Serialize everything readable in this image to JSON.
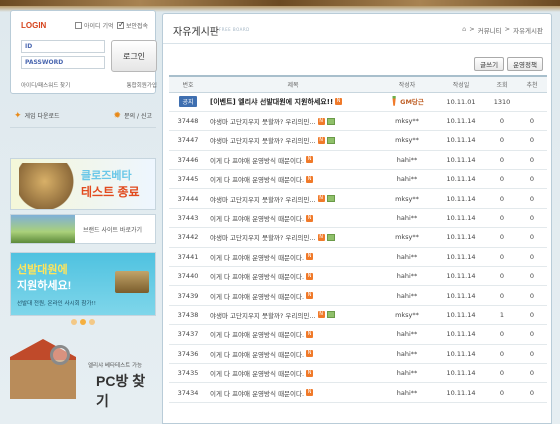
{
  "sidebar": {
    "login": {
      "title": "LOGIN",
      "save_id_label": "아이디 기억",
      "security_label": "보안접속",
      "id_label": "ID",
      "password_label": "PASSWORD",
      "login_button": "로그인",
      "find_link": "아이디/패스워드 찾기",
      "join_link": "통합회원가입"
    },
    "quick": {
      "download": "게임 다운로드",
      "support": "문의 / 신고"
    },
    "banner_cbt": {
      "line1": "클로즈베타",
      "line2": "테스트 종료"
    },
    "banner_brand": {
      "text": "브랜드 사이트 바로가기"
    },
    "banner_recruit": {
      "line1": "선발대원에",
      "line2": "지원하세요!",
      "line3": "선발대 전원, 온라인 사시회 참가!!"
    },
    "banner_pcbang": {
      "small": "엘리샤 베타테스트 가능",
      "big": "PC방 찾기"
    }
  },
  "board": {
    "title": "자유게시판",
    "subtitle": "FREE BOARD",
    "breadcrumb": [
      "커뮤니티",
      "자유게시판"
    ],
    "write_button": "글쓰기",
    "policy_button": "운영정책",
    "columns": [
      "번호",
      "제목",
      "작성자",
      "작성일",
      "조회",
      "추천"
    ],
    "notice": {
      "badge": "공지",
      "subject": "[이벤트] 엘리샤 선발대원에 지원하세요!!",
      "author": "GM당근",
      "date": "10.11.01",
      "views": "1310",
      "recommend": ""
    },
    "rows": [
      {
        "no": "37448",
        "subject": "야생마 고단지우지 뭇할까? 우리의민...",
        "img": true,
        "author": "mksy**",
        "date": "10.11.14",
        "views": "0",
        "recommend": "0"
      },
      {
        "no": "37447",
        "subject": "야생마 고단지우지 뭇할까? 우리의민...",
        "img": true,
        "author": "mksy**",
        "date": "10.11.14",
        "views": "0",
        "recommend": "0"
      },
      {
        "no": "37446",
        "subject": "이게 다 프야애 운영방식 때문이다.",
        "img": false,
        "author": "hahi**",
        "date": "10.11.14",
        "views": "0",
        "recommend": "0"
      },
      {
        "no": "37445",
        "subject": "이게 다 프야애 운영방식 때문이다.",
        "img": false,
        "author": "hahi**",
        "date": "10.11.14",
        "views": "0",
        "recommend": "0"
      },
      {
        "no": "37444",
        "subject": "야생마 고단지우지 뭇할까? 우리의민...",
        "img": true,
        "author": "mksy**",
        "date": "10.11.14",
        "views": "0",
        "recommend": "0"
      },
      {
        "no": "37443",
        "subject": "이게 다 프야애 운영방식 때문이다.",
        "img": false,
        "author": "hahi**",
        "date": "10.11.14",
        "views": "0",
        "recommend": "0"
      },
      {
        "no": "37442",
        "subject": "야생마 고단지우지 뭇할까? 우리의민...",
        "img": true,
        "author": "mksy**",
        "date": "10.11.14",
        "views": "0",
        "recommend": "0"
      },
      {
        "no": "37441",
        "subject": "이게 다 프야애 운영방식 때문이다.",
        "img": false,
        "author": "hahi**",
        "date": "10.11.14",
        "views": "0",
        "recommend": "0"
      },
      {
        "no": "37440",
        "subject": "이게 다 프야애 운영방식 때문이다.",
        "img": false,
        "author": "hahi**",
        "date": "10.11.14",
        "views": "0",
        "recommend": "0"
      },
      {
        "no": "37439",
        "subject": "이게 다 프야애 운영방식 때문이다.",
        "img": false,
        "author": "hahi**",
        "date": "10.11.14",
        "views": "0",
        "recommend": "0"
      },
      {
        "no": "37438",
        "subject": "야생마 고단지우지 뭇할까? 우리의민...",
        "img": true,
        "author": "mksy**",
        "date": "10.11.14",
        "views": "1",
        "recommend": "0"
      },
      {
        "no": "37437",
        "subject": "이게 다 프야애 운영방식 때문이다.",
        "img": false,
        "author": "hahi**",
        "date": "10.11.14",
        "views": "0",
        "recommend": "0"
      },
      {
        "no": "37436",
        "subject": "이게 다 프야애 운영방식 때문이다.",
        "img": false,
        "author": "hahi**",
        "date": "10.11.14",
        "views": "0",
        "recommend": "0"
      },
      {
        "no": "37435",
        "subject": "이게 다 프야애 운영방식 때문이다.",
        "img": false,
        "author": "hahi**",
        "date": "10.11.14",
        "views": "0",
        "recommend": "0"
      },
      {
        "no": "37434",
        "subject": "이게 다 프야애 운영방식 때문이다.",
        "img": false,
        "author": "hahi**",
        "date": "10.11.14",
        "views": "0",
        "recommend": "0"
      }
    ]
  },
  "colors": {
    "accent": "#d6431c",
    "notice_badge": "#3f6fb0",
    "new_icon": "#f07a2a"
  }
}
